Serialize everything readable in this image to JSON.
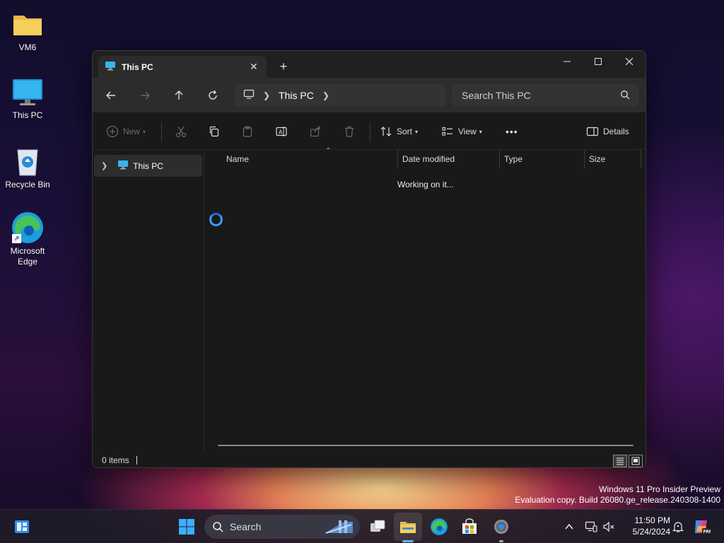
{
  "desktop": {
    "icons": [
      {
        "label": "VM6",
        "icon": "folder-icon"
      },
      {
        "label": "This PC",
        "icon": "monitor-icon"
      },
      {
        "label": "Recycle Bin",
        "icon": "recycle-bin-icon"
      },
      {
        "label": "Microsoft Edge",
        "icon": "edge-icon"
      }
    ],
    "watermark": {
      "line1": "Windows 11 Pro Insider Preview",
      "line2": "Evaluation copy. Build 26080.ge_release.240308-1400"
    }
  },
  "explorer": {
    "tab": {
      "label": "This PC",
      "close": "✕"
    },
    "new_tab": "+",
    "address": {
      "location": "This PC"
    },
    "search": {
      "placeholder": "Search This PC"
    },
    "commands": {
      "new": "New",
      "sort": "Sort",
      "view": "View",
      "more": "•••",
      "details": "Details"
    },
    "nav_pane": {
      "items": [
        {
          "label": "This PC"
        }
      ]
    },
    "columns": [
      "Name",
      "Date modified",
      "Type",
      "Size"
    ],
    "status_message": "Working on it...",
    "status_bar": {
      "item_count": "0 items"
    }
  },
  "taskbar": {
    "search_label": "Search",
    "clock": {
      "time": "11:50 PM",
      "date": "5/24/2024"
    }
  },
  "colors": {
    "accent": "#3aa0ff",
    "window_bg": "#191919",
    "toolbar_bg": "#2c2c2c"
  }
}
